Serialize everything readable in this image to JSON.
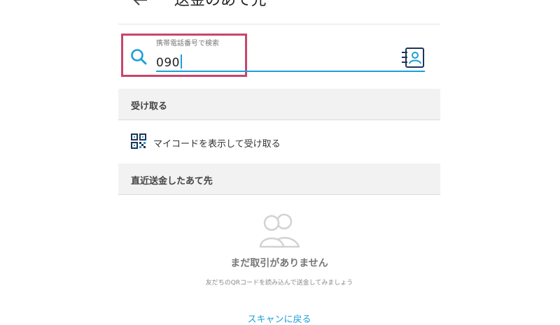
{
  "header": {
    "title": "送金のあて先",
    "back_icon": "arrow-left-icon"
  },
  "search": {
    "label": "携帯電話番号で検索",
    "value": "090",
    "search_icon": "search-icon",
    "contact_icon": "address-book-icon"
  },
  "sections": {
    "receive": {
      "title": "受け取る",
      "item_label": "マイコードを表示して受け取る",
      "item_icon": "qr-code-icon"
    },
    "recent": {
      "title": "直近送金したあて先"
    }
  },
  "empty_state": {
    "icon": "users-icon",
    "title": "まだ取引がありません",
    "subtitle": "友だちのQRコードを読み込んで送金してみましょう",
    "action_label": "スキャンに戻る"
  },
  "colors": {
    "accent": "#1a9fd8",
    "highlight": "#c8456c",
    "icon_navy": "#1f3556"
  }
}
